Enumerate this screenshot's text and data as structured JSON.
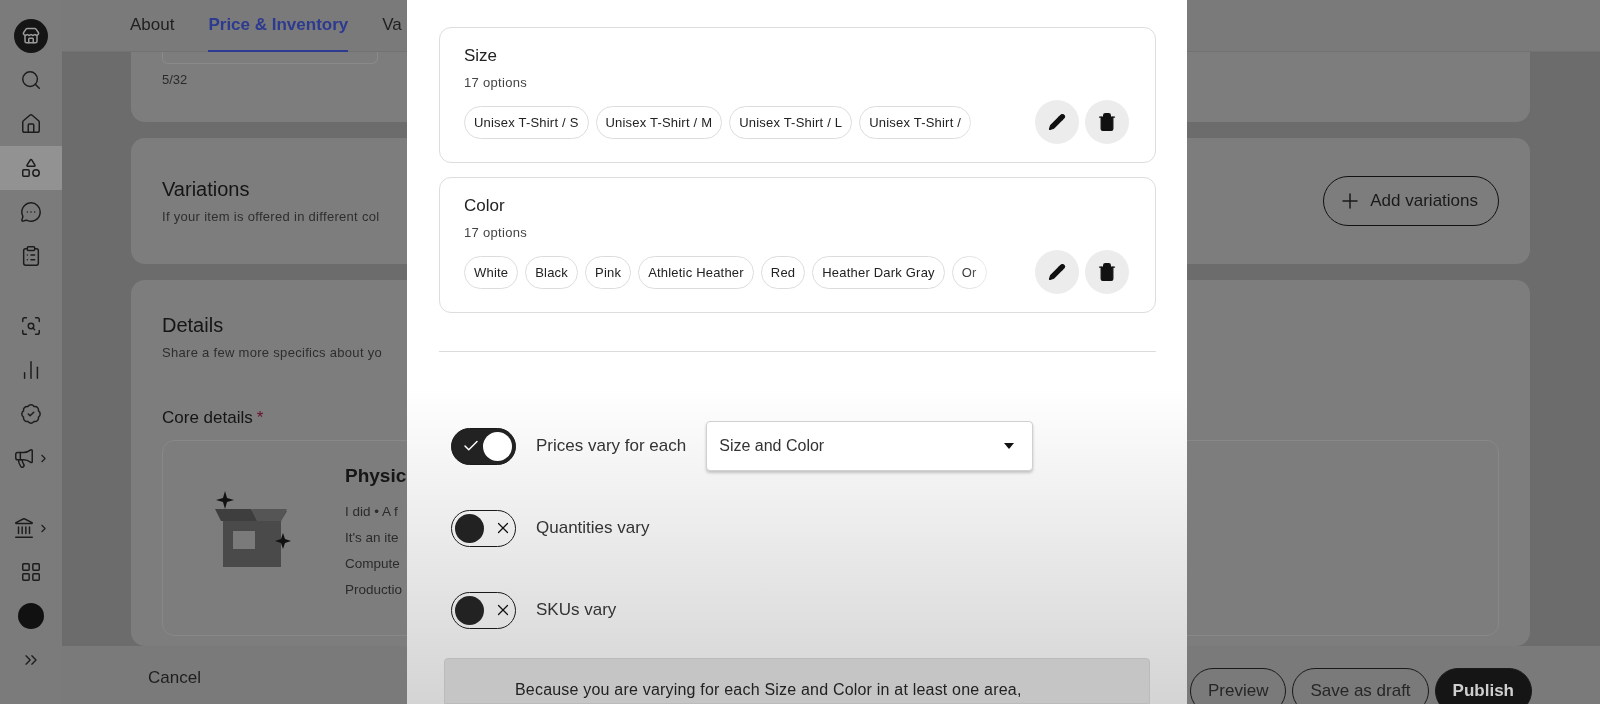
{
  "sidebar": {
    "groups": [
      {
        "items": [
          {
            "kind": "logo",
            "selected": false,
            "has_submenu": false
          },
          {
            "kind": "search",
            "selected": false,
            "has_submenu": false
          },
          {
            "kind": "home",
            "selected": false,
            "has_submenu": false
          },
          {
            "kind": "shapes",
            "selected": true,
            "has_submenu": false
          },
          {
            "kind": "messages",
            "selected": false,
            "has_submenu": false
          },
          {
            "kind": "orders",
            "selected": false,
            "has_submenu": false
          }
        ]
      },
      {
        "items": [
          {
            "kind": "insights",
            "selected": false,
            "has_submenu": false
          },
          {
            "kind": "stats",
            "selected": false,
            "has_submenu": false
          },
          {
            "kind": "badge",
            "selected": false,
            "has_submenu": false
          },
          {
            "kind": "marketing",
            "selected": false,
            "has_submenu": true
          }
        ]
      },
      {
        "items": [
          {
            "kind": "finances",
            "selected": false,
            "has_submenu": true
          },
          {
            "kind": "apps",
            "selected": false,
            "has_submenu": false
          },
          {
            "kind": "avatar",
            "selected": false,
            "has_submenu": false
          },
          {
            "kind": "expand",
            "selected": false,
            "has_submenu": false
          }
        ]
      }
    ]
  },
  "tabs": [
    {
      "label": "About",
      "selected": false
    },
    {
      "label": "Price & Inventory",
      "selected": true
    },
    {
      "label": "Va",
      "selected": false
    }
  ],
  "title_card": {
    "counter": "5/32"
  },
  "variations_card": {
    "title": "Variations",
    "description": "If your item is offered in different col",
    "button": "Add variations"
  },
  "details_card": {
    "title": "Details",
    "description": "Share a few more specifics about yo",
    "core_label": "Core details",
    "required_mark": "*",
    "type_title": "Physic",
    "type_lines": [
      "I did • A f",
      "It's an ite",
      "Compute",
      "Productio"
    ]
  },
  "footer": {
    "cancel": "Cancel",
    "buttons": [
      {
        "label": "Preview",
        "kind": "outline"
      },
      {
        "label": "Save as draft",
        "kind": "outline"
      },
      {
        "label": "Publish",
        "kind": "primary"
      }
    ]
  },
  "modal": {
    "variations": [
      {
        "name": "Size",
        "count": "17 options",
        "options": [
          "Unisex T-Shirt / S",
          "Unisex T-Shirt / M",
          "Unisex T-Shirt / L",
          "Unisex T-Shirt /"
        ]
      },
      {
        "name": "Color",
        "count": "17 options",
        "options": [
          "White",
          "Black",
          "Pink",
          "Athletic Heather",
          "Red",
          "Heather Dark Gray",
          "Or"
        ]
      }
    ],
    "toggles": [
      {
        "label": "Prices vary for each",
        "on": true,
        "select": "Size and Color"
      },
      {
        "label": "Quantities vary",
        "on": false
      },
      {
        "label": "SKUs vary",
        "on": false
      }
    ],
    "notice": "Because you are varying for each Size and Color in at least one area,"
  }
}
